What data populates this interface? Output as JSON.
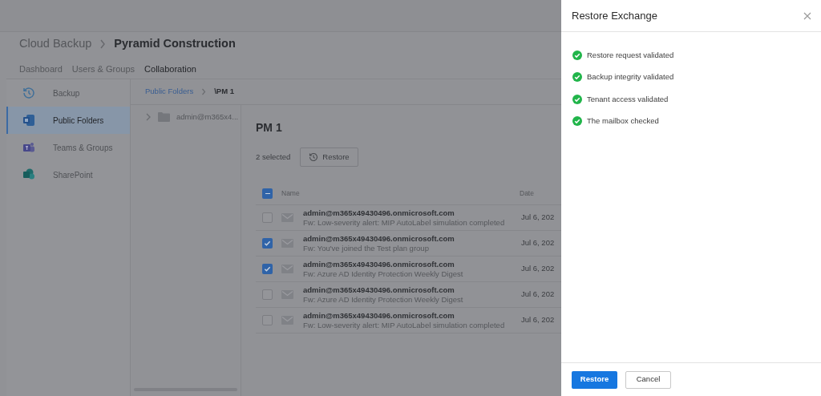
{
  "header": {
    "breadcrumb": [
      "Cloud Backup",
      "Pyramid Construction"
    ]
  },
  "tabs": [
    {
      "label": "Dashboard",
      "selected": false
    },
    {
      "label": "Users & Groups",
      "selected": false
    },
    {
      "label": "Collaboration",
      "selected": true
    }
  ],
  "sidebar": {
    "items": [
      {
        "label": "Backup",
        "kind": "backup",
        "selected": false
      },
      {
        "label": "Public Folders",
        "kind": "exchange",
        "selected": true
      },
      {
        "label": "Teams & Groups",
        "kind": "teams",
        "selected": false
      },
      {
        "label": "SharePoint",
        "kind": "sharepoint",
        "selected": false
      }
    ]
  },
  "path": {
    "link": "Public Folders",
    "current": "\\PM 1"
  },
  "tree": {
    "items": [
      {
        "label": "admin@m365x4...",
        "expanded": false
      }
    ]
  },
  "list": {
    "title": "PM 1",
    "selection_count": "2 selected",
    "restore_button": "Restore",
    "columns": [
      "Name",
      "Date"
    ],
    "select_all_indeterminate": true,
    "rows": [
      {
        "sender": "admin@m365x49430496.onmicrosoft.com",
        "subject": "Fw: Low-severity alert: MIP AutoLabel simulation completed",
        "date": "Jul 6, 202",
        "checked": false
      },
      {
        "sender": "admin@m365x49430496.onmicrosoft.com",
        "subject": "Fw: You've joined the Test plan group",
        "date": "Jul 6, 202",
        "checked": true
      },
      {
        "sender": "admin@m365x49430496.onmicrosoft.com",
        "subject": "Fw: Azure AD Identity Protection Weekly Digest",
        "date": "Jul 6, 202",
        "checked": true
      },
      {
        "sender": "admin@m365x49430496.onmicrosoft.com",
        "subject": "Fw: Azure AD Identity Protection Weekly Digest",
        "date": "Jul 6, 202",
        "checked": false
      },
      {
        "sender": "admin@m365x49430496.onmicrosoft.com",
        "subject": "Fw: Low-severity alert: MIP AutoLabel simulation completed",
        "date": "Jul 6, 202",
        "checked": false
      }
    ]
  },
  "drawer": {
    "title": "Restore Exchange",
    "steps": [
      {
        "label": "Restore request validated",
        "done": true
      },
      {
        "label": "Backup integrity validated",
        "done": true
      },
      {
        "label": "Tenant access validated",
        "done": true
      },
      {
        "label": "The mailbox checked",
        "done": true
      }
    ],
    "buttons": [
      {
        "label": "Restore",
        "kind": "primary"
      },
      {
        "label": "Cancel",
        "kind": "secondary"
      }
    ]
  }
}
